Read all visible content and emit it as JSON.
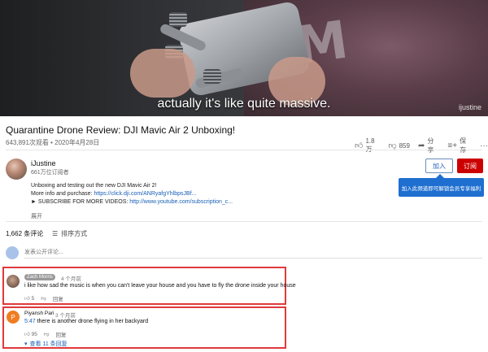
{
  "player": {
    "subtitle": "actually it's like quite massive.",
    "watermark": "ijustine"
  },
  "video": {
    "title": "Quarantine Drone Review: DJI Mavic Air 2 Unboxing!",
    "meta": "643,891次观看 • 2020年4月28日",
    "likes": "1.8万",
    "dislikes": "859",
    "share": "分享",
    "save": "保存"
  },
  "channel": {
    "name": "iJustine",
    "subscribers": "661万位订阅者",
    "join": "加入",
    "subscribe": "订阅",
    "tooltip": "加入此频道即可解锁会员专享福利"
  },
  "description": {
    "line1": "Unboxing and testing out the new DJI Mavic Air 2!",
    "line2_prefix": "More info and purchase: ",
    "line2_link": "https://click.dji.com/ANRyafgYhlbpsJBf...",
    "line3_prefix": "► SUBSCRIBE FOR MORE VIDEOS: ",
    "line3_link": "http://www.youtube.com/subscription_c...",
    "more": "展开"
  },
  "comments": {
    "count": "1,662 条评论",
    "sort": "排序方式",
    "placeholder": "发表公开评论...",
    "items": [
      {
        "author": "Zach Morris",
        "time": "4 个月前",
        "text": "i like how sad the music is when you can't leave your house and you have to fly the drone inside your house",
        "likes": "5",
        "reply": "回复"
      },
      {
        "author": "Piyansh Pari",
        "initial": "P",
        "time": "3 个月前",
        "timestamp": "5:47",
        "text": " there is another drone flying in her backyard",
        "likes": "95",
        "reply": "回复",
        "view_replies": "查看 11 条回复"
      }
    ]
  },
  "colors": {
    "accent_red": "#e0393b",
    "subscribe_red": "#cc0000",
    "link_blue": "#1a5fb4",
    "tooltip_blue": "#1f6fd0"
  }
}
